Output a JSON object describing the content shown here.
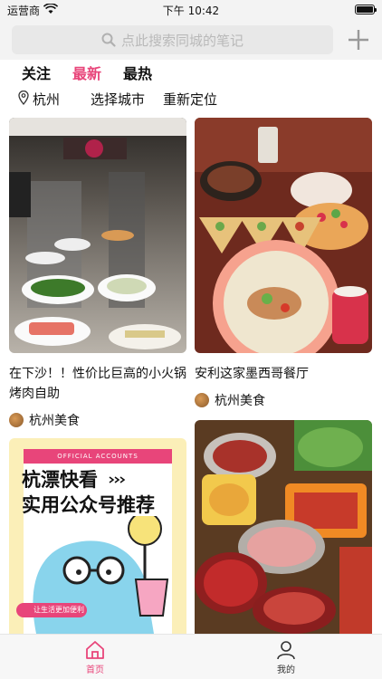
{
  "status": {
    "carrier": "运营商",
    "time": "下午 10:42"
  },
  "search": {
    "placeholder": "点此搜索同城的笔记"
  },
  "tabs": [
    {
      "label": "关注",
      "active": false
    },
    {
      "label": "最新",
      "active": true
    },
    {
      "label": "最热",
      "active": false
    }
  ],
  "location": {
    "city": "杭州",
    "choose": "选择城市",
    "relocate": "重新定位"
  },
  "feed": [
    {
      "title": "在下沙！！性价比巨高的小火锅烤肉自助",
      "author": "杭州美食"
    },
    {
      "title": "安利这家墨西哥餐厅",
      "author": "杭州美食"
    },
    {
      "poster_header": "OFFICIAL ACCOUNTS",
      "poster_line1": "杭漂快看",
      "poster_line2": "实用公众号推荐",
      "poster_tag": "让生活更加便利"
    },
    {}
  ],
  "bottom_nav": [
    {
      "label": "首页",
      "active": true
    },
    {
      "label": "我的",
      "active": false
    }
  ],
  "colors": {
    "accent": "#e8457a"
  },
  "icons": {
    "search": "search-icon",
    "add": "plus-icon",
    "pin": "location-pin-icon",
    "home": "home-icon",
    "me": "person-icon"
  }
}
